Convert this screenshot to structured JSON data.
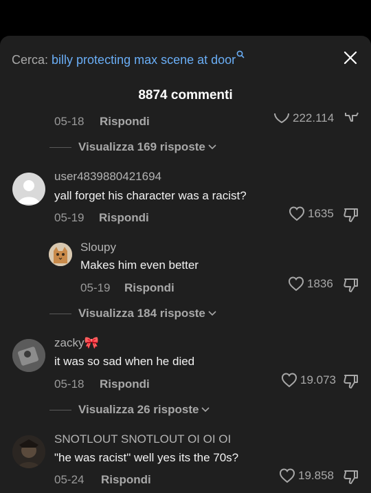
{
  "search": {
    "label": "Cerca:",
    "query": "billy protecting max scene at door"
  },
  "comments_header": "8874 commenti",
  "partial_comment": {
    "date": "05-18",
    "reply": "Rispondi",
    "likes": "222.114"
  },
  "view_replies": [
    {
      "label": "Visualizza 169 risposte"
    },
    {
      "label": "Visualizza 184 risposte"
    },
    {
      "label": "Visualizza 26 risposte"
    }
  ],
  "comments": [
    {
      "username": "user4839880421694",
      "text": "yall forget his character was a racist?",
      "date": "05-19",
      "reply": "Rispondi",
      "likes": "1635"
    },
    {
      "username": "Sloupy",
      "text": "Makes him even better",
      "date": "05-19",
      "reply": "Rispondi",
      "likes": "1836"
    },
    {
      "username": "zacky🎀",
      "text": "it was so sad when he died",
      "date": "05-18",
      "reply": "Rispondi",
      "likes": "19.073"
    },
    {
      "username": "SNOTLOUT SNOTLOUT OI OI OI",
      "text": "\"he was racist\" well yes its the 70s?",
      "date": "05-24",
      "reply": "Rispondi",
      "likes": "19.858"
    }
  ],
  "colors": {
    "background": "#000000",
    "sheet": "#1f1f1f",
    "link": "#6aaef6",
    "muted": "#a8a8a8"
  },
  "icons": [
    "search-icon",
    "close-icon",
    "heart-icon",
    "dislike-icon",
    "chevron-down-icon"
  ]
}
